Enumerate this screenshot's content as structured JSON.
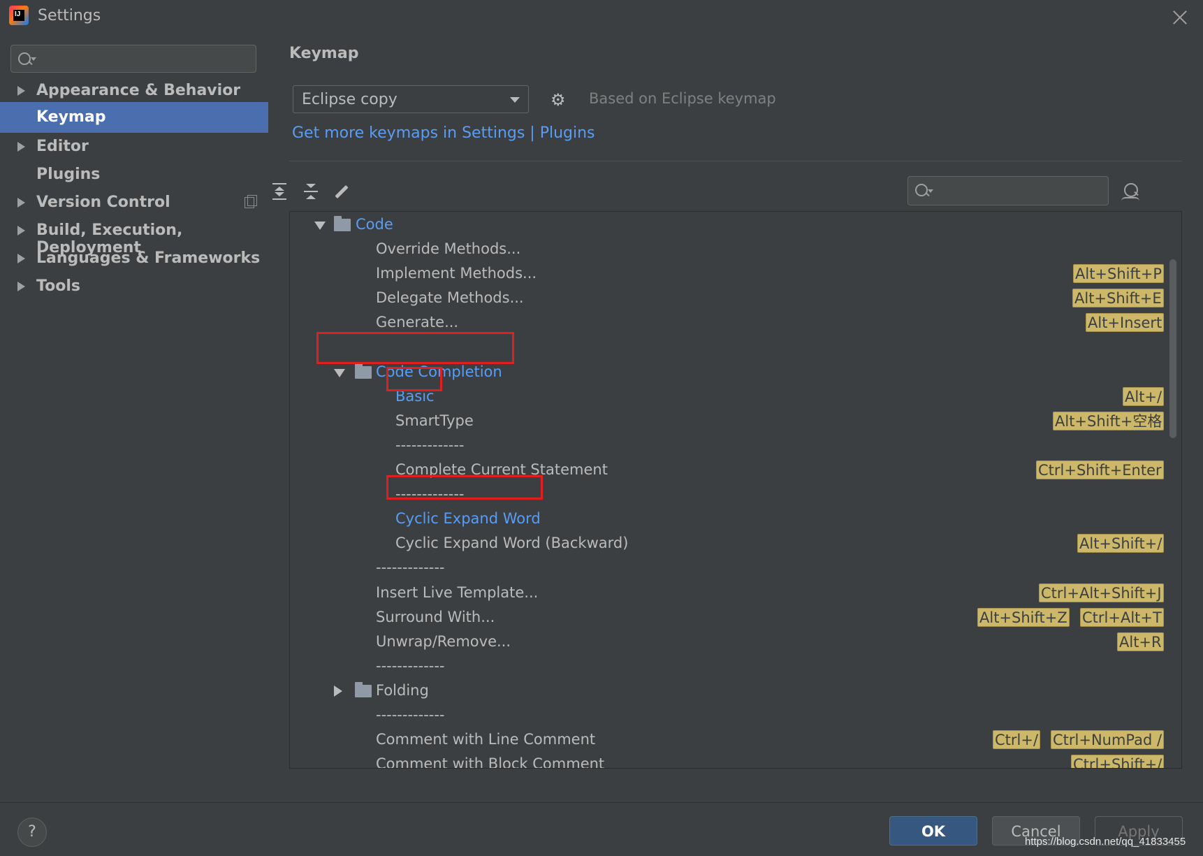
{
  "window": {
    "title": "Settings",
    "logo_text": "IJ"
  },
  "sidebar": {
    "search_placeholder": "",
    "items": [
      {
        "label": "Appearance & Behavior",
        "expandable": true,
        "selected": false
      },
      {
        "label": "Keymap",
        "expandable": false,
        "selected": true
      },
      {
        "label": "Editor",
        "expandable": true,
        "selected": false
      },
      {
        "label": "Plugins",
        "expandable": false,
        "selected": false
      },
      {
        "label": "Version Control",
        "expandable": true,
        "selected": false
      },
      {
        "label": "Build, Execution, Deployment",
        "expandable": true,
        "selected": false
      },
      {
        "label": "Languages & Frameworks",
        "expandable": true,
        "selected": false
      },
      {
        "label": "Tools",
        "expandable": true,
        "selected": false
      }
    ]
  },
  "main": {
    "heading": "Keymap",
    "keymap_selected": "Eclipse copy",
    "based_on": "Based on Eclipse keymap",
    "more_link": "Get more keymaps in Settings | Plugins",
    "tree_search_placeholder": ""
  },
  "tree": [
    {
      "text": "Code",
      "kind": "folder",
      "expanded": true,
      "highlight": true,
      "shortcuts": []
    },
    {
      "text": "Override Methods...",
      "kind": "action",
      "shortcuts": []
    },
    {
      "text": "Implement Methods...",
      "kind": "action",
      "shortcuts": [
        "Alt+Shift+P"
      ]
    },
    {
      "text": "Delegate Methods...",
      "kind": "action",
      "shortcuts": [
        "Alt+Shift+E"
      ]
    },
    {
      "text": "Generate...",
      "kind": "action",
      "shortcuts": [
        "Alt+Insert"
      ]
    },
    {
      "text": "",
      "kind": "blank",
      "shortcuts": []
    },
    {
      "text": "Code Completion",
      "kind": "folder",
      "expanded": true,
      "highlight": true,
      "shortcuts": []
    },
    {
      "text": "Basic",
      "kind": "action",
      "highlight": true,
      "shortcuts": [
        "Alt+/"
      ]
    },
    {
      "text": "SmartType",
      "kind": "action",
      "shortcuts": [
        "Alt+Shift+空格"
      ]
    },
    {
      "text": "-------------",
      "kind": "separator",
      "shortcuts": []
    },
    {
      "text": "Complete Current Statement",
      "kind": "action",
      "shortcuts": [
        "Ctrl+Shift+Enter"
      ]
    },
    {
      "text": "-------------",
      "kind": "separator",
      "shortcuts": []
    },
    {
      "text": "Cyclic Expand Word",
      "kind": "action",
      "highlight": true,
      "shortcuts": []
    },
    {
      "text": "Cyclic Expand Word (Backward)",
      "kind": "action",
      "shortcuts": [
        "Alt+Shift+/"
      ]
    },
    {
      "text": "-------------",
      "kind": "separator",
      "shortcuts": []
    },
    {
      "text": "Insert Live Template...",
      "kind": "action",
      "shortcuts": [
        "Ctrl+Alt+Shift+J"
      ]
    },
    {
      "text": "Surround With...",
      "kind": "action",
      "shortcuts": [
        "Alt+Shift+Z",
        "Ctrl+Alt+T"
      ]
    },
    {
      "text": "Unwrap/Remove...",
      "kind": "action",
      "shortcuts": [
        "Alt+R"
      ]
    },
    {
      "text": "-------------",
      "kind": "separator",
      "shortcuts": []
    },
    {
      "text": "Folding",
      "kind": "folder",
      "expanded": false,
      "highlight": false,
      "shortcuts": []
    },
    {
      "text": "-------------",
      "kind": "separator",
      "shortcuts": []
    },
    {
      "text": "Comment with Line Comment",
      "kind": "action",
      "shortcuts": [
        "Ctrl+/",
        "Ctrl+NumPad /"
      ]
    },
    {
      "text": "Comment with Block Comment",
      "kind": "action",
      "shortcuts": [
        "Ctrl+Shift+/"
      ]
    }
  ],
  "footer": {
    "help": "?",
    "ok": "OK",
    "cancel": "Cancel",
    "apply": "Apply",
    "watermark": "https://blog.csdn.net/qq_41833455"
  },
  "colors": {
    "background": "#3c3f41",
    "selection": "#4b6eaf",
    "link": "#589df6",
    "shortcut_bg": "#cdb869",
    "annotation": "#e02020"
  }
}
